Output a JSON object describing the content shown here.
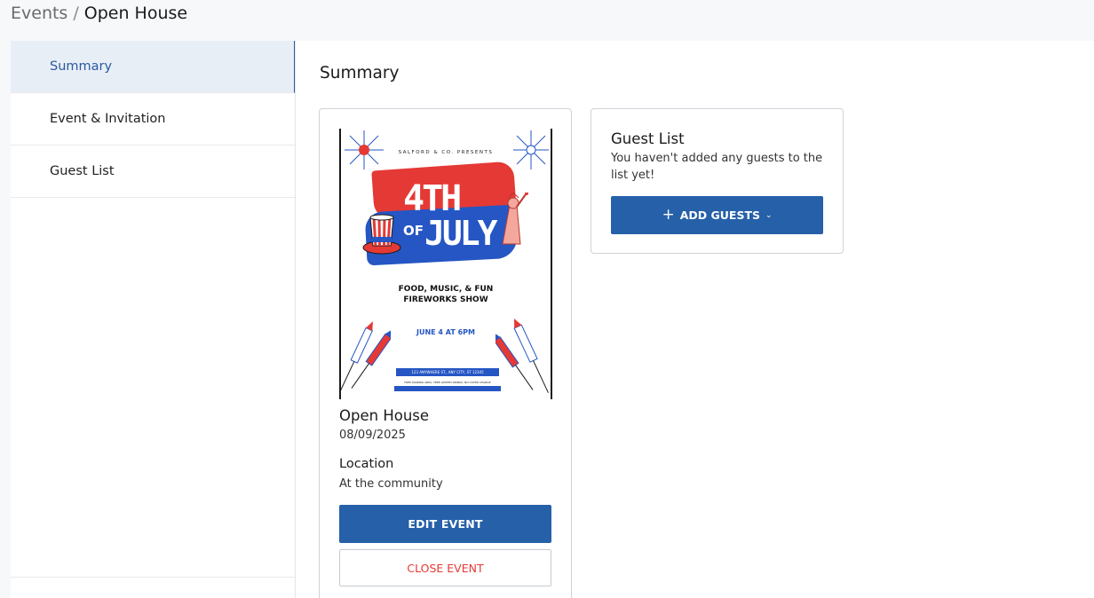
{
  "breadcrumb": {
    "parent": "Events",
    "separator": "/",
    "current": "Open House"
  },
  "sidebar": {
    "items": [
      {
        "label": "Summary",
        "active": true
      },
      {
        "label": "Event & Invitation",
        "active": false
      },
      {
        "label": "Guest List",
        "active": false
      }
    ]
  },
  "main": {
    "title": "Summary"
  },
  "event": {
    "flyer": {
      "presents": "SALFORD & CO. PRESENTS",
      "headline_top": "4TH",
      "headline_of": "OF",
      "headline_bottom": "JULY",
      "line1": "FOOD, MUSIC, & FUN",
      "line2": "FIREWORKS SHOW",
      "date": "JUNE 4 AT 6PM",
      "address": "123 ANYWHERE ST., ANY CITY, ST 12345",
      "fine_print": "FREE PARKING AREA, FREE LIMITED DRINKS, NO COVER CHARGE"
    },
    "name": "Open House",
    "date": "08/09/2025",
    "location_label": "Location",
    "location_value": "At the community",
    "edit_label": "EDIT EVENT",
    "close_label": "CLOSE EVENT"
  },
  "guest_list": {
    "title": "Guest List",
    "message": "You haven't added any guests to the list yet!",
    "add_label": "ADD GUESTS",
    "plus_icon": "+",
    "chevron_icon": "⌄"
  },
  "colors": {
    "primary": "#2660a8",
    "danger": "#e53935",
    "active_bg": "#e8eef6",
    "page_bg": "#f7f8fa"
  }
}
